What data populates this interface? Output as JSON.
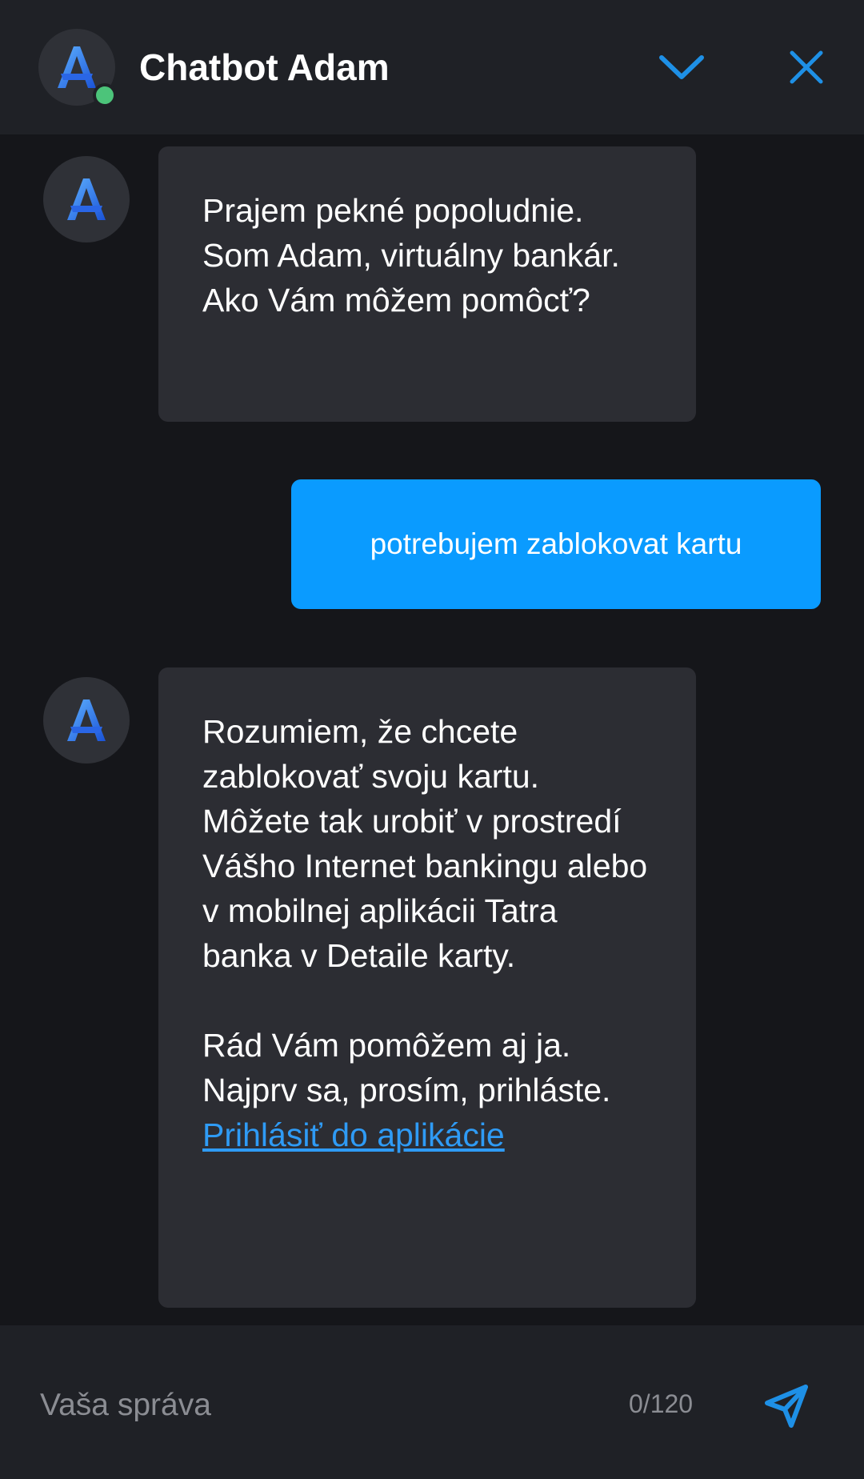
{
  "header": {
    "title": "Chatbot Adam",
    "status": "online",
    "avatar_letter": "A",
    "collapse_icon": "chevron-down-icon",
    "close_icon": "close-icon"
  },
  "messages": [
    {
      "sender": "bot",
      "avatar_letter": "A",
      "text": "Prajem pekné popoludnie. Som Adam, virtuálny bankár. Ako Vám môžem pomôcť?"
    },
    {
      "sender": "user",
      "text": "potrebujem zablokovat kartu"
    },
    {
      "sender": "bot",
      "avatar_letter": "A",
      "text": "Rozumiem, že chcete zablokovať svoju kartu. Môžete tak urobiť v prostredí Vášho Internet bankingu alebo v mobilnej aplikácii Tatra banka v Detaile karty.",
      "text2": "Rád Vám pomôžem aj ja. Najprv sa, prosím, prihláste.",
      "link": "Prihlásiť do aplikácie"
    }
  ],
  "composer": {
    "placeholder": "Vaša správa",
    "value": "",
    "counter": "0/120",
    "send_icon": "send-icon"
  },
  "colors": {
    "background": "#15161a",
    "header": "#1f2126",
    "bot_bubble": "#2c2d33",
    "user_bubble": "#0a9bff",
    "accent": "#1e90e6",
    "link": "#2f9bf5",
    "online": "#4cc47a"
  }
}
